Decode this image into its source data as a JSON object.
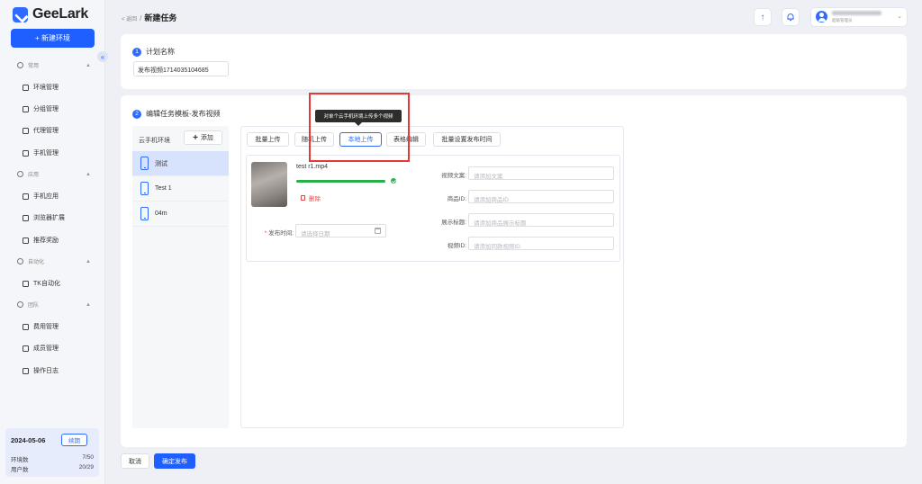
{
  "app": {
    "logo_text": "GeeLark",
    "new_env_label": "+ 新建环境",
    "collapse_glyph": "«"
  },
  "sidebar": {
    "sections": [
      {
        "label": "常用",
        "items": [
          "环境管理",
          "分组管理",
          "代理管理",
          "手机管理"
        ]
      },
      {
        "label": "应用",
        "items": [
          "手机应用",
          "浏览器扩展",
          "推荐奖励"
        ]
      },
      {
        "label": "自动化",
        "items": [
          "TK自动化"
        ]
      },
      {
        "label": "团队",
        "items": [
          "费用管理",
          "成员管理",
          "操作日志"
        ]
      }
    ],
    "quota": {
      "date": "2024-05-06",
      "renew_label": "续期",
      "env_count_label": "环境数",
      "env_count_value": "7/50",
      "user_count_label": "用户数",
      "user_count_value": "20/29"
    }
  },
  "header": {
    "back_label": "< 返回",
    "separator": "/",
    "title": "新建任务",
    "user_role": "超级管理员"
  },
  "plan": {
    "step_number": "1",
    "step_title": "计划名称",
    "name_value": "发布视频1714035104685"
  },
  "template": {
    "step_number": "2",
    "step_title": "编辑任务模板-发布视频",
    "env_header": "云手机环境",
    "add_label": "添加",
    "environments": [
      "测试",
      "Test 1",
      "04m"
    ],
    "toolbar": [
      "批量上传",
      "随机上传",
      "本地上传",
      "表格编辑",
      "批量设置发布时间"
    ],
    "active_tool": "本地上传",
    "tooltip": "对单个云手机环境上传多个视频",
    "video": {
      "file_name": "test r1.mp4",
      "progress_percent": 100,
      "delete_label": "删除",
      "publish_time_label": "发布时间:",
      "publish_time_placeholder": "请选择日期",
      "fields": [
        {
          "label": "视频文案:",
          "placeholder": "请添加文案"
        },
        {
          "label": "商品ID:",
          "placeholder": "请添加商品ID"
        },
        {
          "label": "展示标题:",
          "placeholder": "请添加商品展示标题"
        },
        {
          "label": "视频ID:",
          "placeholder": "请添加同款视频ID"
        }
      ]
    }
  },
  "footer": {
    "cancel_label": "取消",
    "confirm_label": "确定发布"
  },
  "colors": {
    "accent": "#1f5fff",
    "success": "#27b04a",
    "danger": "#e04848",
    "highlight": "#e53935"
  }
}
